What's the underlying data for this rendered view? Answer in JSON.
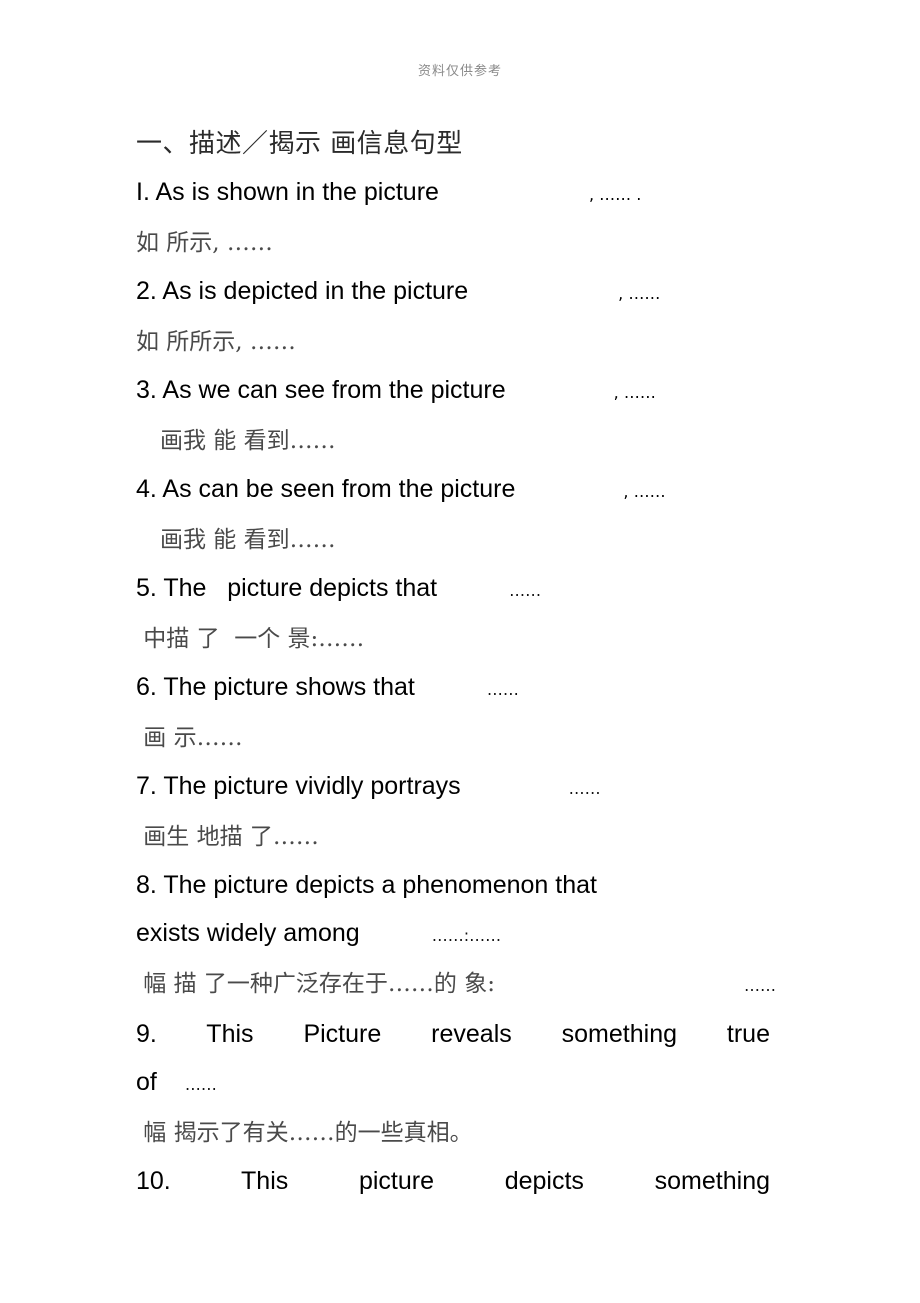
{
  "header": {
    "watermark": "资料仅供参考"
  },
  "document": {
    "title": "一、描述／揭示 画信息句型",
    "ellipsis": "……",
    "comma": ",",
    "period": ".",
    "colon": ":",
    "items": [
      {
        "number": "I.",
        "english": "I. As is shown in the picture",
        "english_tail": ", …… .",
        "chinese": "如 所示, ……"
      },
      {
        "number": "2.",
        "english": "2. As is depicted in the picture",
        "english_tail": ", ……",
        "chinese": "如 所所示, ……"
      },
      {
        "number": "3.",
        "english": "3. As we can see from the picture",
        "english_tail": ", ……",
        "chinese": "画我 能 看到……"
      },
      {
        "number": "4.",
        "english": "4. As can be seen from the picture",
        "english_tail": ", ……",
        "chinese": "画我 能 看到……"
      },
      {
        "number": "5.",
        "english": "5. The   picture depicts that",
        "english_tail": "……",
        "chinese": " 中描 了  一个 景:……"
      },
      {
        "number": "6.",
        "english": "6. The picture shows that",
        "english_tail": "……",
        "chinese": " 画 示……"
      },
      {
        "number": "7.",
        "english": "7. The picture vividly portrays",
        "english_tail": "……",
        "chinese": " 画生 地描 了……"
      },
      {
        "number": "8.",
        "english": "8. The picture depicts a phenomenon that",
        "english_line2": "exists widely among",
        "english_tail": "……:……",
        "chinese": " 幅 描 了一种广泛存在于……的 象:",
        "chinese_tail": "……"
      },
      {
        "number": "9.",
        "english": "9. This Picture reveals something true",
        "english_line2": "of",
        "english_tail": "……",
        "chinese": " 幅 揭示了有关……的一些真相。"
      },
      {
        "number": "10.",
        "english": "10. This picture depicts something"
      }
    ]
  }
}
